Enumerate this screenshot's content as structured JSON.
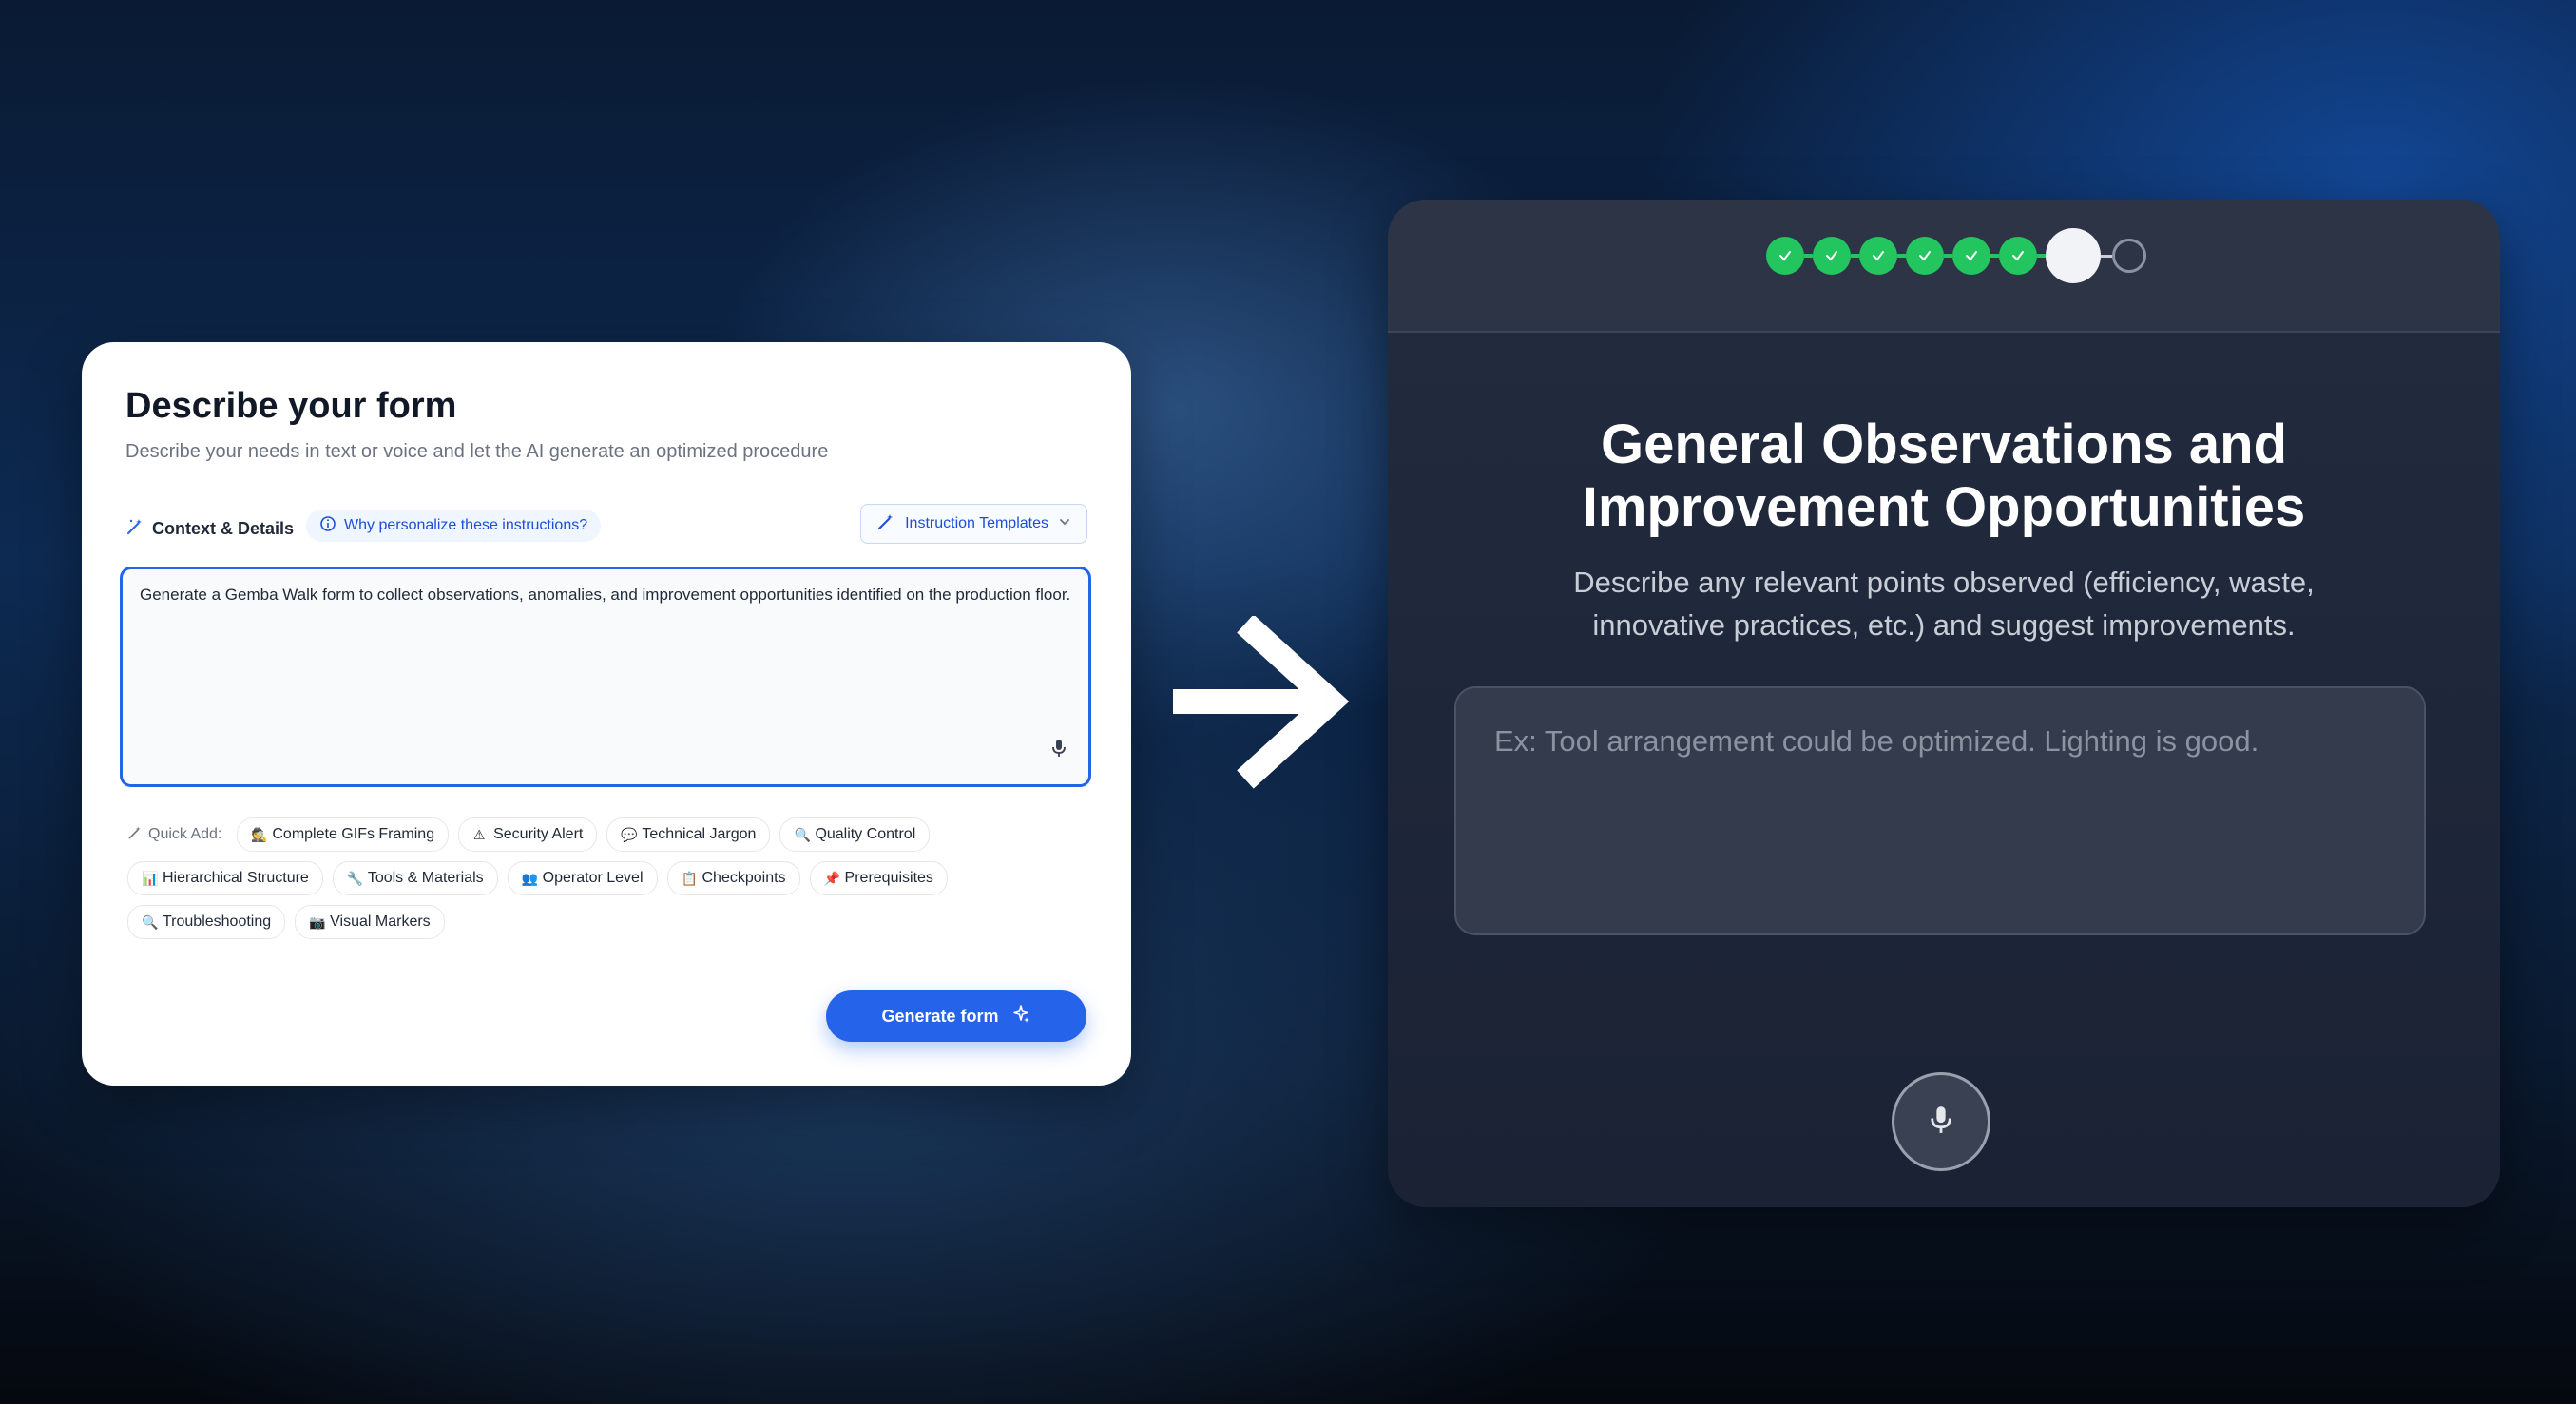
{
  "left_card": {
    "title": "Describe your form",
    "subtitle": "Describe your needs in text or voice and let the AI generate an optimized procedure",
    "context_label": "Context & Details",
    "why_link": "Why personalize these instructions?",
    "templates_button": "Instruction Templates",
    "prompt_text": "Generate a Gemba Walk form to collect observations, anomalies, and improvement opportunities identified on the production floor.",
    "quick_add_label": "Quick Add:",
    "chips": [
      {
        "icon": "🕵",
        "label": "Complete GIFs Framing"
      },
      {
        "icon": "⚠",
        "label": "Security Alert"
      },
      {
        "icon": "💬",
        "label": "Technical Jargon"
      },
      {
        "icon": "🔍",
        "label": "Quality Control"
      },
      {
        "icon": "📊",
        "label": "Hierarchical Structure"
      },
      {
        "icon": "🔧",
        "label": "Tools & Materials"
      },
      {
        "icon": "👥",
        "label": "Operator Level"
      },
      {
        "icon": "📋",
        "label": "Checkpoints"
      },
      {
        "icon": "📌",
        "label": "Prerequisites"
      },
      {
        "icon": "🔍",
        "label": "Troubleshooting"
      },
      {
        "icon": "📷",
        "label": "Visual Markers"
      }
    ],
    "generate_button": "Generate form"
  },
  "right_card": {
    "progress": {
      "completed": 6,
      "current": 7,
      "total": 8
    },
    "title_line1": "General Observations and",
    "title_line2": "Improvement Opportunities",
    "subtitle_line1": "Describe any relevant points observed (efficiency, waste,",
    "subtitle_line2": "innovative practices, etc.) and suggest improvements.",
    "input_placeholder": "Ex: Tool arrangement could be optimized. Lighting is good."
  },
  "colors": {
    "accent": "#2563eb",
    "step_done": "#22c55e",
    "card_dark": "#1f2738"
  }
}
